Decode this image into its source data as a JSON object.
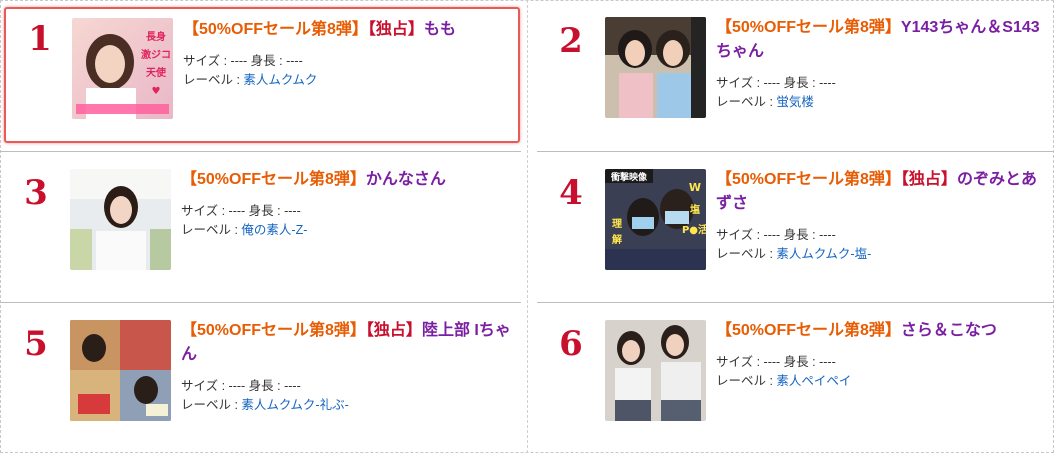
{
  "ranking": [
    {
      "rank": "1",
      "sale": "【50%OFFセール第8弾】",
      "exclusive": "【独占】",
      "name": "もも",
      "size": "サイズ : ---- 身長 : ----",
      "label_prefix": "レーベル : ",
      "label": "素人ムクムク",
      "thumb_text": "長身・激ジコ天使 チアコスでイクッ♥",
      "highlighted": true
    },
    {
      "rank": "2",
      "sale": "【50%OFFセール第8弾】",
      "exclusive": "",
      "name": "Y143ちゃん＆S143ちゃん",
      "size": "サイズ : ---- 身長 : ----",
      "label_prefix": "レーベル : ",
      "label": "蛍気楼",
      "thumb_text": "",
      "highlighted": false
    },
    {
      "rank": "3",
      "sale": "【50%OFFセール第8弾】",
      "exclusive": "",
      "name": "かんなさん",
      "size": "サイズ : ---- 身長 : ----",
      "label_prefix": "レーベル : ",
      "label": "俺の素人-Z-",
      "thumb_text": "",
      "highlighted": false
    },
    {
      "rank": "4",
      "sale": "【50%OFFセール第8弾】",
      "exclusive": "【独占】",
      "name": "のぞみとあずさ",
      "size": "サイズ : ---- 身長 : ----",
      "label_prefix": "レーベル : ",
      "label": "素人ムクムク-塩-",
      "thumb_text": "衝撃映像 W塩対応P●活 理解らせた",
      "highlighted": false
    },
    {
      "rank": "5",
      "sale": "【50%OFFセール第8弾】",
      "exclusive": "【独占】",
      "name": "陸上部 Iちゃん",
      "size": "サイズ : ---- 身長 : ----",
      "label_prefix": "レーベル : ",
      "label": "素人ムクムク-礼ぶ-",
      "thumb_text": "",
      "highlighted": false
    },
    {
      "rank": "6",
      "sale": "【50%OFFセール第8弾】",
      "exclusive": "",
      "name": "さら＆こなつ",
      "size": "サイズ : ---- 身長 : ----",
      "label_prefix": "レーベル : ",
      "label": "素人ペイペイ",
      "thumb_text": "",
      "highlighted": false
    }
  ],
  "colors": {
    "rank": "#c8102e",
    "sale": "#e85d04",
    "exclusive": "#c8102e",
    "name": "#7b1fa2",
    "label_link": "#1565c0",
    "highlight_border": "#e85a5a"
  }
}
